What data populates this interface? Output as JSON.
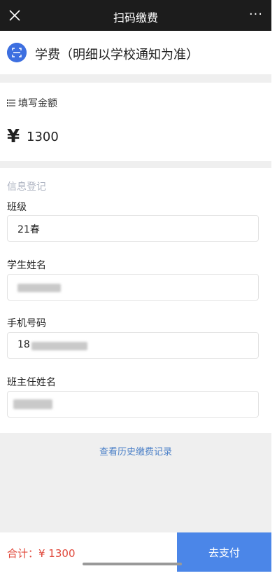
{
  "topbar": {
    "title": "扫码缴费",
    "more": "···"
  },
  "header": {
    "title": "学费（明细以学校通知为准）"
  },
  "amount": {
    "label": "填写金额",
    "currency": "¥",
    "value": "1300"
  },
  "form": {
    "section_title": "信息登记",
    "class_label": "班级",
    "class_value": "21春",
    "student_name_label": "学生姓名",
    "phone_label": "手机号码",
    "phone_value_partial": "18",
    "teacher_name_label": "班主任姓名"
  },
  "history": {
    "link": "查看历史缴费记录"
  },
  "footer": {
    "total": "合计：¥ 1300",
    "pay": "去支付"
  },
  "colors": {
    "accent": "#4b86e8",
    "total_red": "#e0483b",
    "link_blue": "#4a7fc7"
  }
}
